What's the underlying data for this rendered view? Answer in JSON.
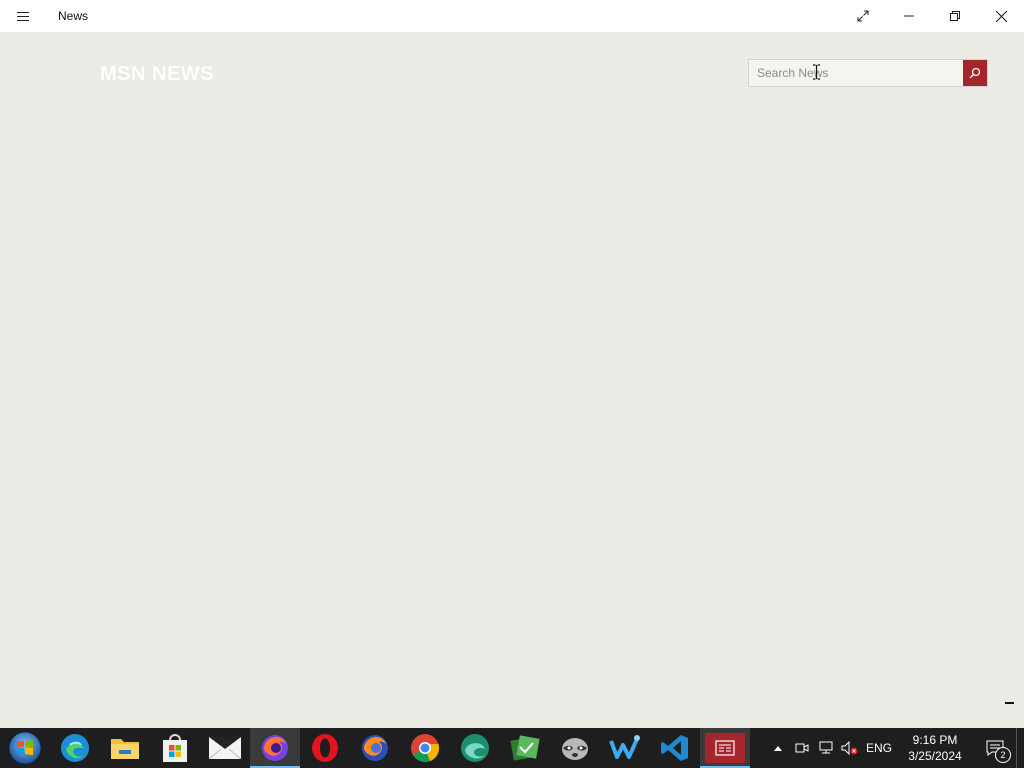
{
  "window": {
    "title": "News"
  },
  "header": {
    "logo_text": "MSN NEWS",
    "search": {
      "placeholder": "Search News",
      "value": ""
    }
  },
  "taskbar": {
    "apps": [
      {
        "name": "start",
        "icon": "windows-start-icon"
      },
      {
        "name": "edge",
        "icon": "edge-icon"
      },
      {
        "name": "file-explorer",
        "icon": "folder-icon"
      },
      {
        "name": "store",
        "icon": "store-icon"
      },
      {
        "name": "mail",
        "icon": "mail-icon"
      },
      {
        "name": "firefox-dev",
        "icon": "firefox-icon",
        "active": true
      },
      {
        "name": "opera",
        "icon": "opera-icon"
      },
      {
        "name": "firefox",
        "icon": "firefox-icon"
      },
      {
        "name": "chrome",
        "icon": "chrome-icon"
      },
      {
        "name": "edge-beta",
        "icon": "edge-beta-icon"
      },
      {
        "name": "app-green",
        "icon": "green-app-icon"
      },
      {
        "name": "raccoon",
        "icon": "raccoon-icon"
      },
      {
        "name": "kde-app",
        "icon": "blue-app-icon"
      },
      {
        "name": "vscode",
        "icon": "vscode-icon"
      },
      {
        "name": "news",
        "icon": "news-icon",
        "active": true
      }
    ],
    "tray": {
      "language": "ENG",
      "time": "9:16 PM",
      "date": "3/25/2024",
      "notification_count": "2"
    }
  },
  "colors": {
    "accent": "#a4262c",
    "background": "#ecece7",
    "taskbar": "#1e1e1e"
  }
}
